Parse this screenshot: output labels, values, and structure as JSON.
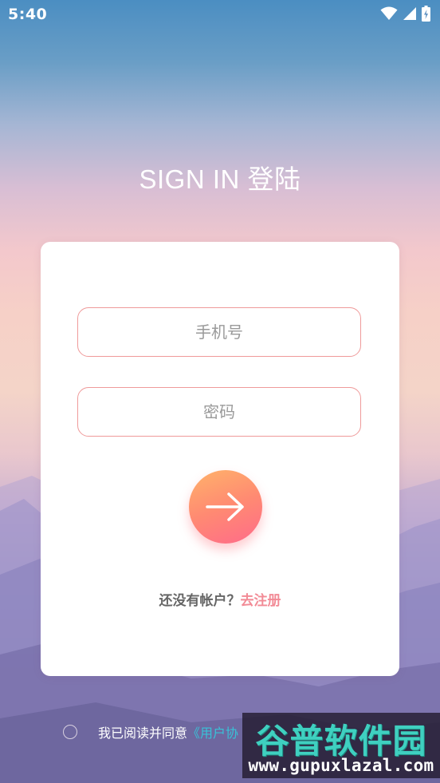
{
  "status_bar": {
    "time": "5:40"
  },
  "title": "SIGN IN 登陆",
  "login_form": {
    "phone_placeholder": "手机号",
    "password_placeholder": "密码",
    "submit_icon": "arrow-right-icon"
  },
  "register": {
    "prompt": "还没有帐户？",
    "link": "去注册"
  },
  "agreement": {
    "text": "我已阅读并同意",
    "link": "《用户协"
  },
  "watermark": {
    "title": "谷普软件园",
    "url": "www.gupuxlazal.com"
  },
  "colors": {
    "accent": "#f28b96",
    "button_start": "#ffb36a",
    "button_end": "#ff6b8a",
    "link_cyan": "#38c2d8"
  }
}
